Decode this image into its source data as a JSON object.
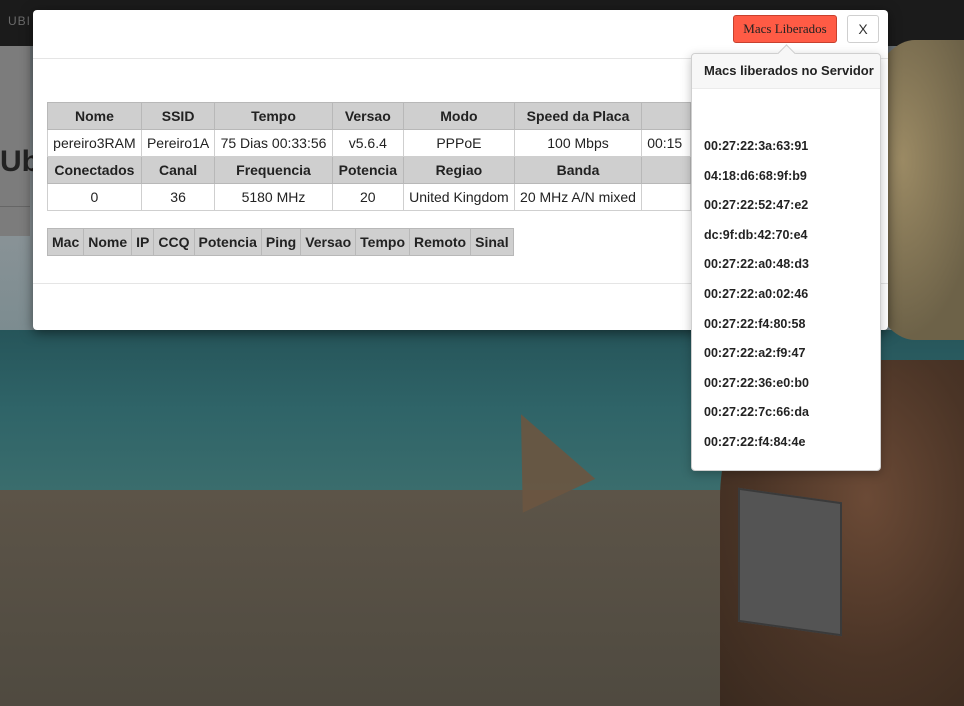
{
  "background": {
    "nav_brand": "UBI",
    "page_title": "Ubi"
  },
  "modal": {
    "macs_button_label": "Macs Liberados",
    "close_button_label": "X",
    "info_table": {
      "row1_headers": [
        "Nome",
        "SSID",
        "Tempo",
        "Versao",
        "Modo",
        "Speed da Placa",
        ""
      ],
      "row1_values": [
        "pereiro3RAM",
        "Pereiro1A",
        "75 Dias 00:33:56",
        "v5.6.4",
        "PPPoE",
        "100 Mbps",
        "00:15"
      ],
      "row2_headers": [
        "Conectados",
        "Canal",
        "Frequencia",
        "Potencia",
        "Regiao",
        "Banda",
        ""
      ],
      "row2_values": [
        "0",
        "36",
        "5180 MHz",
        "20",
        "United Kingdom",
        "20 MHz A/N mixed",
        ""
      ]
    },
    "clients_table": {
      "headers": [
        "Mac",
        "Nome",
        "IP",
        "CCQ",
        "Potencia",
        "Ping",
        "Versao",
        "Tempo",
        "Remoto",
        "Sinal"
      ]
    }
  },
  "popover": {
    "title": "Macs liberados no Servidor",
    "macs": [
      "00:27:22:3a:63:91",
      "04:18:d6:68:9f:b9",
      "00:27:22:52:47:e2",
      "dc:9f:db:42:70:e4",
      "00:27:22:a0:48:d3",
      "00:27:22:a0:02:46",
      "00:27:22:f4:80:58",
      "00:27:22:a2:f9:47",
      "00:27:22:36:e0:b0",
      "00:27:22:7c:66:da",
      "00:27:22:f4:84:4e"
    ]
  },
  "colors": {
    "macs_button": "#ff5b45",
    "table_header": "#cfcfcf",
    "overlay_dark": "#111111"
  }
}
